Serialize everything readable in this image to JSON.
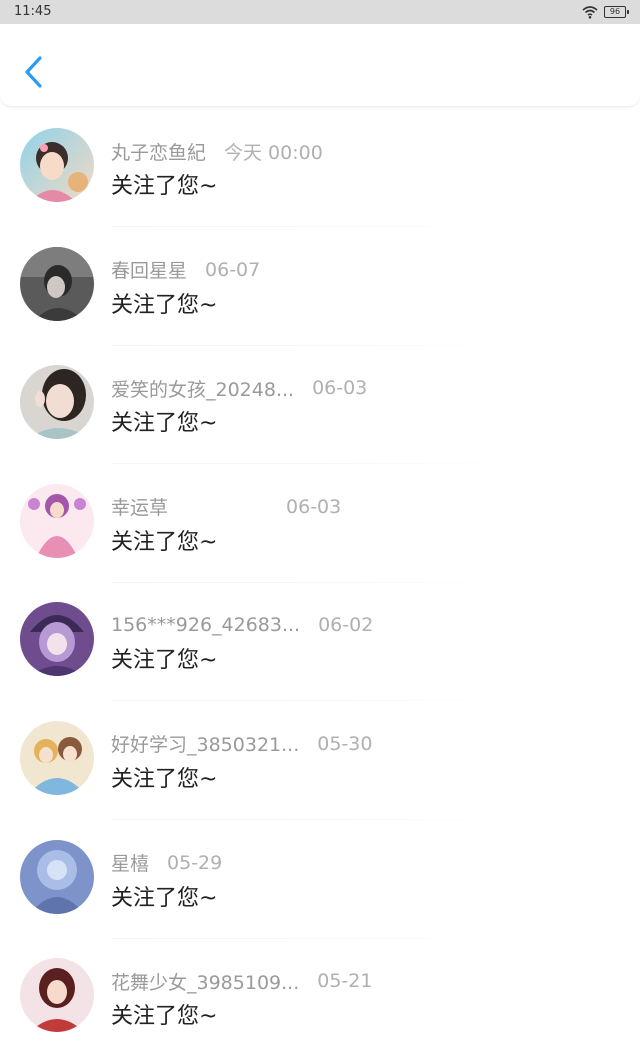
{
  "status_bar": {
    "time": "11:45",
    "battery": "96"
  },
  "header": {
    "back_icon": "chevron-left-icon",
    "accent_color": "#2a9bf5"
  },
  "feed": {
    "items": [
      {
        "name": "丸子恋鱼紀",
        "time": "今天 00:00",
        "text": "关注了您~"
      },
      {
        "name": "春回星星",
        "time": "06-07",
        "text": "关注了您~"
      },
      {
        "name": "爱笑的女孩_20248...",
        "time": "06-03",
        "text": "关注了您~"
      },
      {
        "name": "幸运草",
        "time": "06-03",
        "text": "关注了您~"
      },
      {
        "name": "156***926_42683...",
        "time": "06-02",
        "text": "关注了您~"
      },
      {
        "name": "好好学习_3850321...",
        "time": "05-30",
        "text": "关注了您~"
      },
      {
        "name": "星橲",
        "time": "05-29",
        "text": "关注了您~"
      },
      {
        "name": "花舞少女_3985109...",
        "time": "05-21",
        "text": "关注了您~"
      }
    ]
  }
}
